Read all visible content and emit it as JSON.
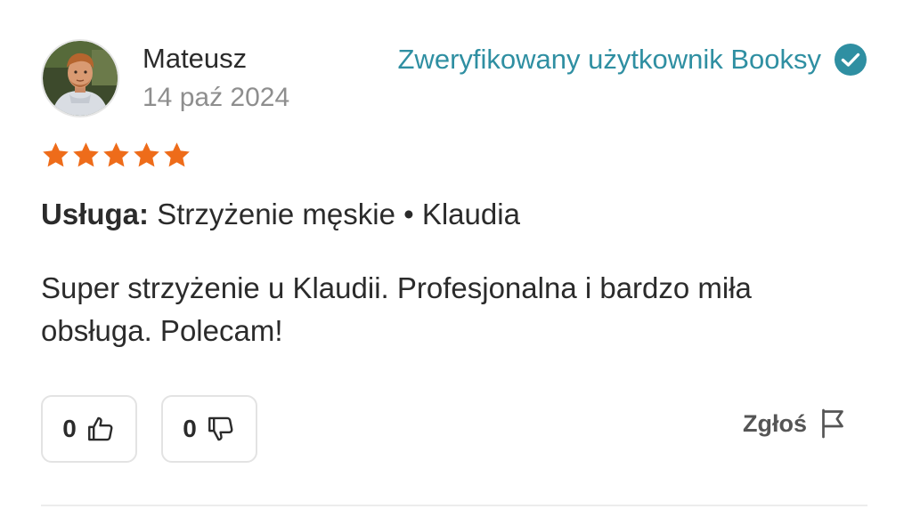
{
  "review": {
    "author": {
      "name": "Mateusz",
      "date": "14 paź 2024"
    },
    "verified": {
      "label": "Zweryfikowany użytkownik Booksy",
      "icon": "check-circle-icon",
      "color": "#2f8fa2"
    },
    "rating": {
      "stars": 5,
      "max": 5,
      "icon": "star-icon",
      "color": "#ee6c1a"
    },
    "service": {
      "label": "Usługa:",
      "value": "Strzyżenie męskie • Klaudia"
    },
    "text": "Super strzyżenie u Klaudii. Profesjonalna i bardzo miła obsługa. Polecam!",
    "votes": {
      "likes": "0",
      "like_icon": "thumbs-up-icon",
      "dislikes": "0",
      "dislike_icon": "thumbs-down-icon"
    },
    "report": {
      "label": "Zgłoś",
      "icon": "flag-icon"
    }
  }
}
